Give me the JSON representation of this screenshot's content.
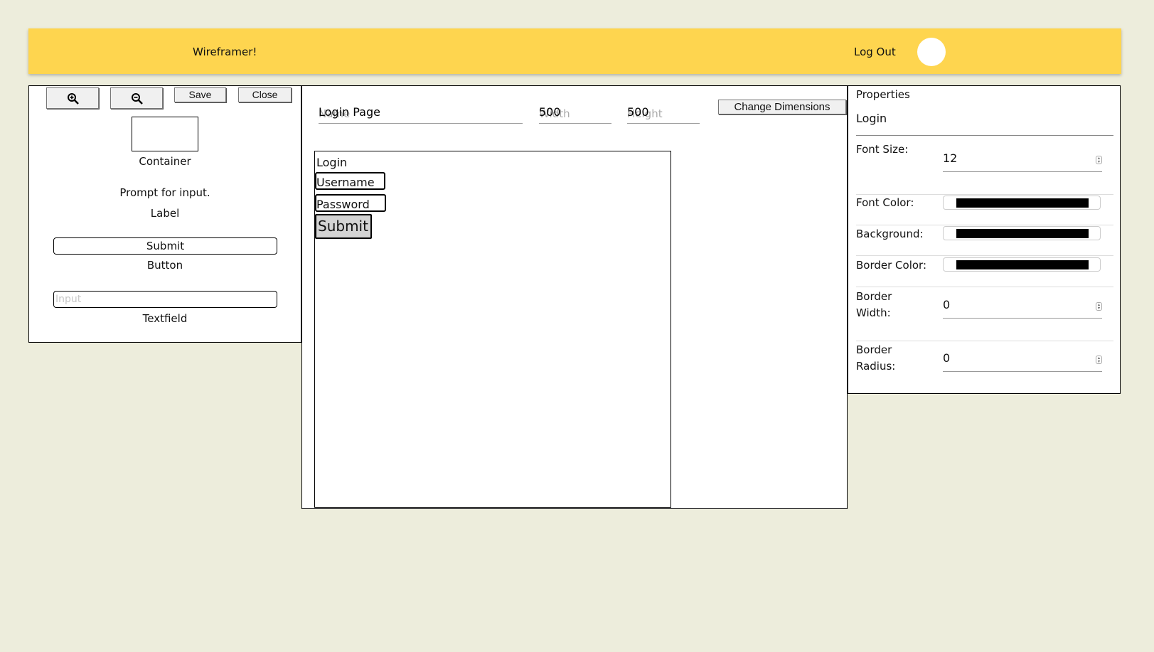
{
  "navbar": {
    "brand": "Wireframer!",
    "logout": "Log Out"
  },
  "toolbox": {
    "zoom_in_icon": "zoom-in",
    "zoom_out_icon": "zoom-out",
    "save_label": "Save",
    "close_label": "Close",
    "container_caption": "Container",
    "label_sample": "Prompt for input.",
    "label_caption": "Label",
    "button_sample": "Submit",
    "button_caption": "Button",
    "textfield_placeholder": "Input",
    "textfield_caption": "Textfield"
  },
  "workspace": {
    "name_value": "Login Page",
    "name_placeholder": "Name",
    "width_value": "500",
    "width_placeholder": "Width",
    "height_value": "500",
    "height_placeholder": "Height",
    "change_dimensions": "Change Dimensions",
    "canvas": {
      "label": "Login",
      "username": "Username",
      "password": "Password",
      "submit": "Submit"
    }
  },
  "properties": {
    "title": "Properties",
    "element_name": "Login",
    "font_size_label": "Font Size:",
    "font_size_value": "12",
    "font_color_label": "Font Color:",
    "font_color": "#000000",
    "background_label": "Background:",
    "background_color": "#000000",
    "border_color_label": "Border Color:",
    "border_color": "#000000",
    "border_width_label_1": "Border",
    "border_width_label_2": "Width:",
    "border_width_value": "0",
    "border_radius_label_1": "Border",
    "border_radius_label_2": "Radius:",
    "border_radius_value": "0"
  },
  "colors": {
    "navbar": "#fed54f",
    "page_background": "#ededdc"
  }
}
